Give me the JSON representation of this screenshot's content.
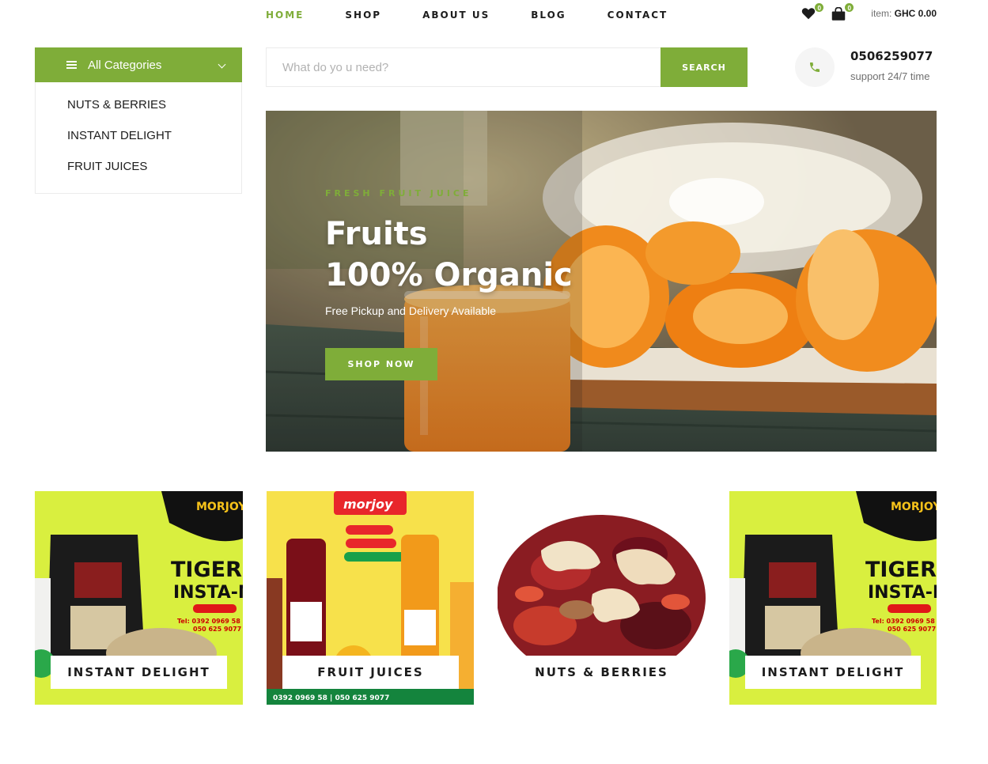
{
  "nav": {
    "items": [
      {
        "label": "HOME",
        "active": true
      },
      {
        "label": "SHOP",
        "active": false
      },
      {
        "label": "ABOUT US",
        "active": false
      },
      {
        "label": "BLOG",
        "active": false
      },
      {
        "label": "CONTACT",
        "active": false
      }
    ]
  },
  "header": {
    "wishlist_count": "0",
    "cart_count": "0",
    "cart_label": "item:",
    "cart_total": "GHC 0.00"
  },
  "categories": {
    "title": "All Categories",
    "items": [
      "NUTS & BERRIES",
      "INSTANT DELIGHT",
      "FRUIT JUICES"
    ]
  },
  "search": {
    "placeholder": "What do yo u need?",
    "button": "SEARCH"
  },
  "contact": {
    "phone": "0506259077",
    "support": "support 24/7 time"
  },
  "hero": {
    "tag": "FRESH FRUIT JUICE",
    "title_line1": "Fruits",
    "title_line2": "100% Organic",
    "subtitle": "Free Pickup and Delivery Available",
    "button": "SHOP NOW"
  },
  "cards": [
    {
      "label": "INSTANT DELIGHT",
      "brand": "MORJOY",
      "product": "TIGERNU",
      "product2": "INSTA-MI",
      "tel": "Tel: 0392 0969 58",
      "tel2": "050 625 9077"
    },
    {
      "label": "FRUIT JUICES",
      "brand": "morjoy",
      "footer": "0392 0969 58 | 050 625 9077"
    },
    {
      "label": "NUTS & BERRIES"
    },
    {
      "label": "INSTANT DELIGHT",
      "brand": "MORJOY",
      "product": "TIGERNU",
      "product2": "INSTA-MI",
      "tel": "Tel: 0392 0969 58",
      "tel2": "050 625 9077"
    }
  ],
  "colors": {
    "accent": "#7fad39",
    "text": "#1c1c1c",
    "muted": "#6f6f6f"
  }
}
